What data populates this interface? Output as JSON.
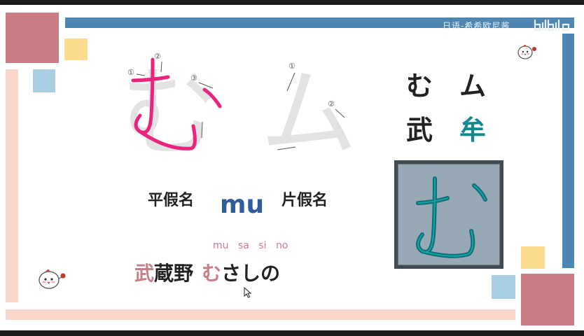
{
  "watermark": "日语-希希欧尼酱",
  "hiragana_label": "平假名",
  "katakana_label": "片假名",
  "romaji": "mu",
  "right_panel": {
    "hiragana": "む",
    "katakana": "ム",
    "hiragana_origin_kanji": "武",
    "katakana_origin_kanji": "牟"
  },
  "reading": [
    "mu",
    "sa",
    "si",
    "no"
  ],
  "example_word": {
    "kanji_highlight": "武",
    "kanji_rest": "蔵野",
    "kana_highlight": "む",
    "kana_rest": "さしの"
  },
  "stroke_numbers": {
    "hiragana": [
      "①",
      "②",
      "③"
    ],
    "katakana": [
      "①",
      "②"
    ]
  },
  "large_hiragana": "む",
  "large_katakana": "ム",
  "colors": {
    "rose": "#c97d85",
    "blue": "#4d86b3",
    "light_blue": "#a8cfe2",
    "yellow": "#fcdd90",
    "peach": "#f9d6cc",
    "magenta": "#e8247e",
    "teal": "#0f8a90"
  },
  "icons": [
    "chick-mascot-icon",
    "bilibili-logo-icon",
    "mouse-cursor-icon"
  ]
}
